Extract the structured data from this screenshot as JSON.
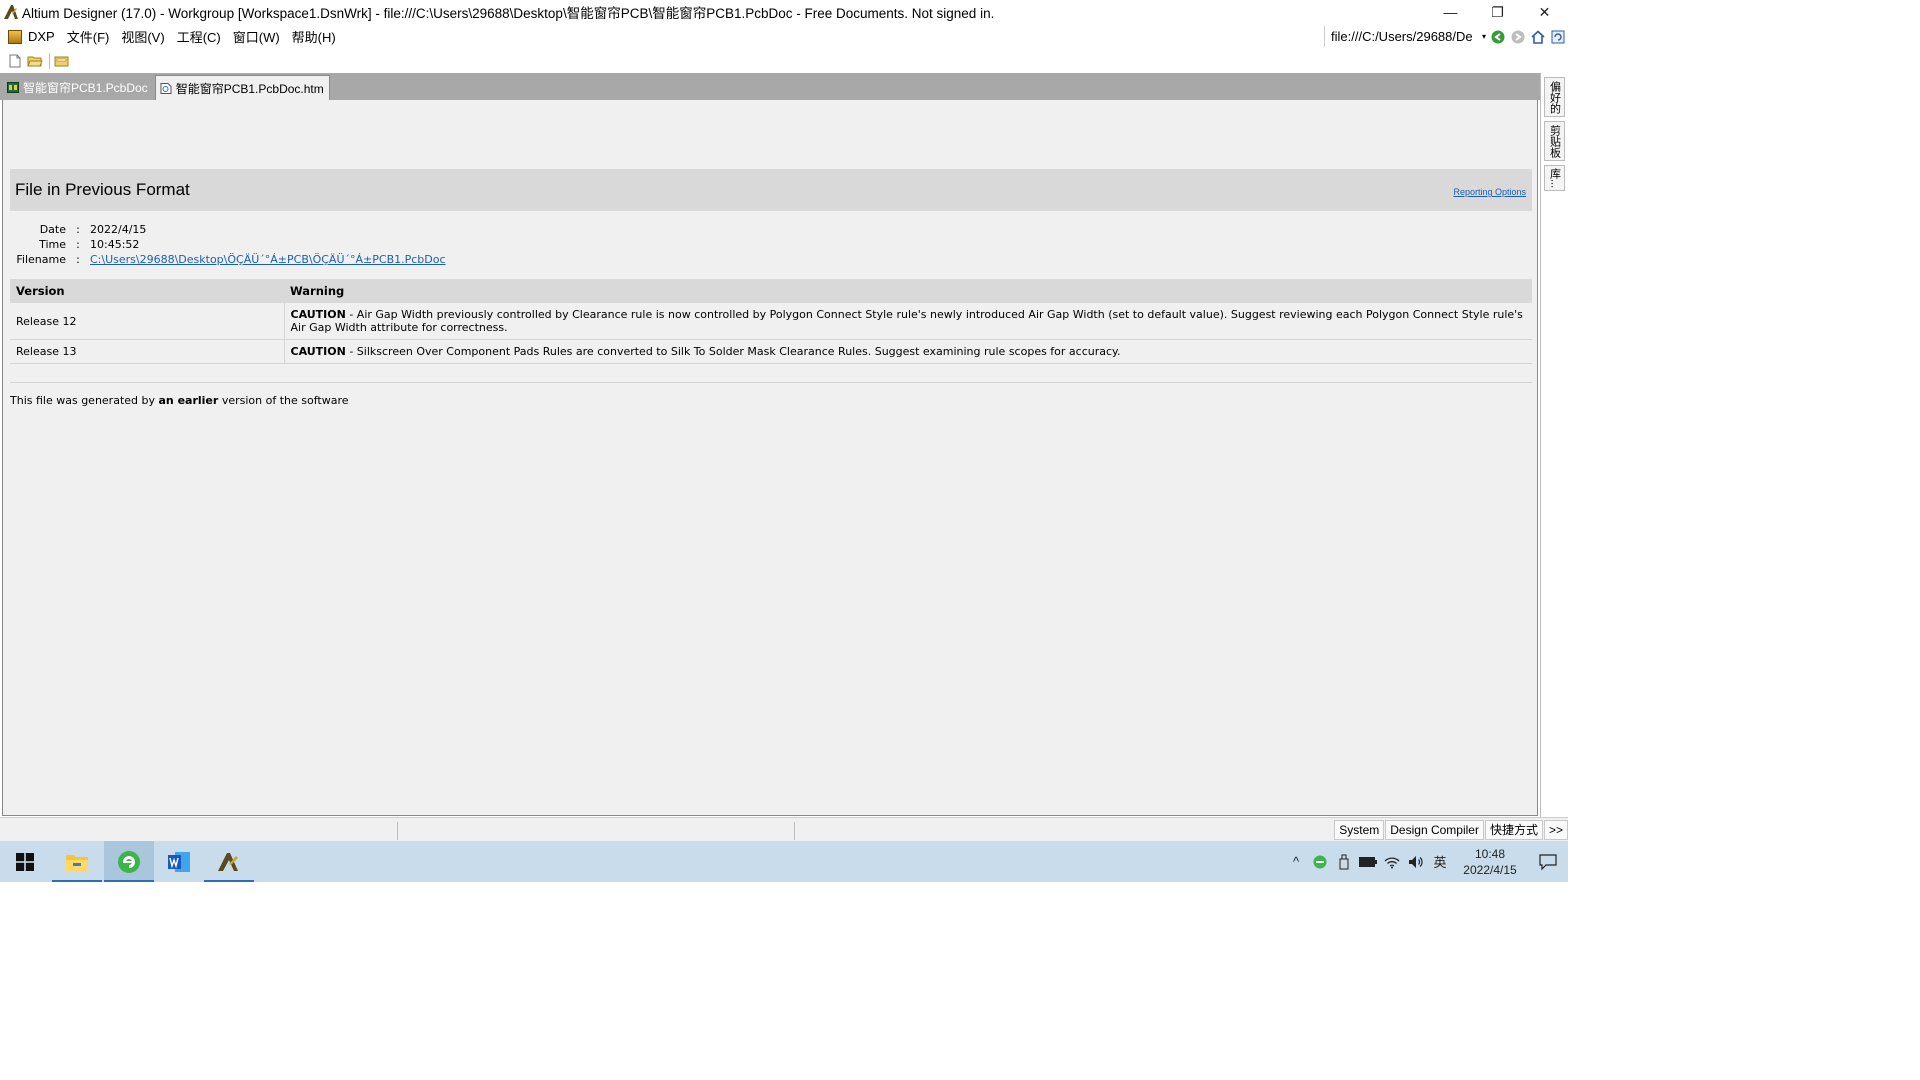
{
  "window": {
    "title": "Altium Designer (17.0) - Workgroup [Workspace1.DsnWrk] - file:///C:\\Users\\29688\\Desktop\\智能窗帘PCB\\智能窗帘PCB1.PcbDoc - Free Documents. Not signed in.",
    "minimize_glyph": "—",
    "restore_glyph": "❐",
    "close_glyph": "✕"
  },
  "menu": {
    "items": [
      "DXP",
      "文件(F)",
      "视图(V)",
      "工程(C)",
      "窗口(W)",
      "帮助(H)"
    ],
    "address": "file:///C:/Users/29688/De",
    "address_drop": "▾",
    "nav_back": "◀",
    "nav_forward": "▶",
    "nav_home": "⌂",
    "nav_refresh": "↻"
  },
  "tabs": [
    {
      "label": "智能窗帘PCB1.PcbDoc",
      "active": false
    },
    {
      "label": "智能窗帘PCB1.PcbDoc.htm",
      "active": true
    }
  ],
  "side_panels": [
    "偏好的",
    "剪贴板",
    "库..."
  ],
  "report": {
    "title": "File in Previous Format",
    "reporting_options": "Reporting Options",
    "meta": [
      {
        "label": "Date",
        "value": "2022/4/15"
      },
      {
        "label": "Time",
        "value": "10:45:52"
      },
      {
        "label": "Filename",
        "value": "C:\\Users\\29688\\Desktop\\ÖÇÄÜ´°Á±PCB\\ÖÇÄÜ´°Á±PCB1.PcbDoc"
      }
    ],
    "colon": ":",
    "table": {
      "headers": [
        "Version",
        "Warning"
      ],
      "rows": [
        {
          "version": "Release 12",
          "tag": "CAUTION",
          "text": " - Air Gap Width previously controlled by Clearance rule is now controlled by Polygon Connect Style rule's newly introduced Air Gap Width (set to default value). Suggest reviewing each Polygon Connect Style rule's Air Gap Width attribute for correctness."
        },
        {
          "version": "Release 13",
          "tag": "CAUTION",
          "text": " - Silkscreen Over Component Pads Rules are converted to Silk To Solder Mask Clearance Rules. Suggest examining rule scopes for accuracy."
        }
      ]
    },
    "footer": {
      "prefix": "This file was generated by ",
      "bold": "an earlier",
      "suffix": " version of the software"
    }
  },
  "statusbar": {
    "buttons": [
      "System",
      "Design Compiler",
      "快捷方式",
      ">>"
    ]
  },
  "taskbar": {
    "tray": {
      "chevron": "^",
      "ime": "英",
      "time": "10:48",
      "date": "2022/4/15"
    }
  }
}
